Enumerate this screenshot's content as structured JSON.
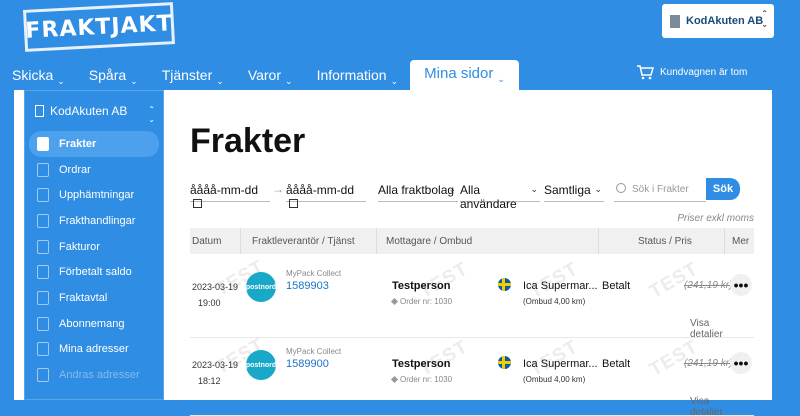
{
  "header": {
    "logo_text": "FRAKTJAKT",
    "company": "KodAkuten AB",
    "cart": "Kundvagnen är tom",
    "nav": [
      {
        "label": "Skicka"
      },
      {
        "label": "Spåra"
      },
      {
        "label": "Tjänster"
      },
      {
        "label": "Varor"
      },
      {
        "label": "Information"
      },
      {
        "label": "Mina sidor"
      }
    ]
  },
  "sidebar": {
    "company": "KodAkuten AB",
    "items": [
      {
        "label": "Frakter"
      },
      {
        "label": "Ordrar"
      },
      {
        "label": "Upphämtningar"
      },
      {
        "label": "Frakthandlingar"
      },
      {
        "label": "Fakturor"
      },
      {
        "label": "Förbetalt saldo"
      },
      {
        "label": "Fraktavtal"
      },
      {
        "label": "Abonnemang"
      },
      {
        "label": "Mina adresser"
      },
      {
        "label": "Andras adresser"
      }
    ]
  },
  "main": {
    "title": "Frakter",
    "date_from": "åååå-mm-dd",
    "date_to": "åååå-mm-dd",
    "filter_carrier": "Alla fraktbolag",
    "filter_user": "Alla användare",
    "filter_status": "Samtliga",
    "search_placeholder": "Sök i Frakter",
    "search_button": "Sök",
    "price_note": "Priser exkl moms",
    "columns": {
      "date": "Datum",
      "carrier": "Fraktleverantör / Tjänst",
      "recipient": "Mottagare / Ombud",
      "status": "Status / Pris",
      "more": "Mer"
    },
    "rows": [
      {
        "date": "2023-03-19",
        "time": "19:00",
        "carrier_logo": "postnord",
        "service": "MyPack Collect",
        "tracking": "1589903",
        "recipient": "Testperson",
        "order": "Order nr: 1030",
        "ombud": "Ica Supermar...",
        "distance": "(Ombud 4,00 km)",
        "status": "Betalt",
        "price": "(241,19 kr)",
        "more": "•••",
        "details": "Visa detaljer"
      },
      {
        "date": "2023-03-19",
        "time": "18:12",
        "carrier_logo": "postnord",
        "service": "MyPack Collect",
        "tracking": "1589900",
        "recipient": "Testperson",
        "order": "Order nr: 1030",
        "ombud": "Ica Supermar...",
        "distance": "(Ombud 4,00 km)",
        "status": "Betalt",
        "price": "(241,19 kr)",
        "more": "•••",
        "details": "Visa detaljer"
      }
    ],
    "watermark": "TEST"
  }
}
